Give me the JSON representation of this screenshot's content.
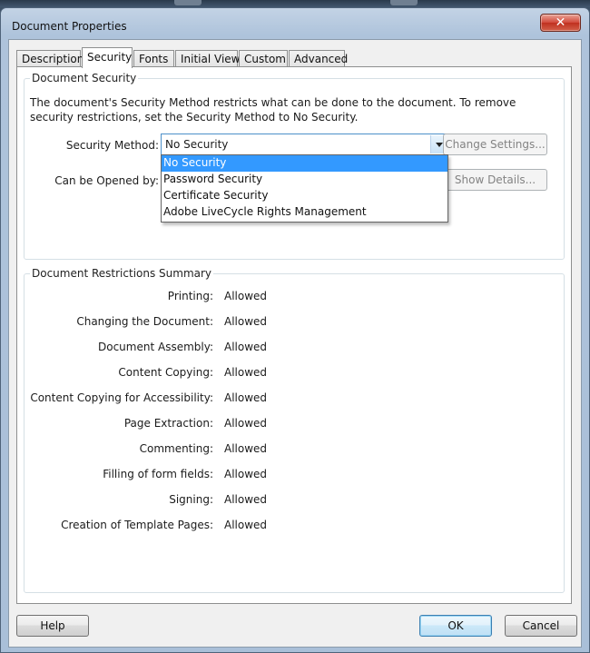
{
  "window": {
    "title": "Document Properties",
    "close_glyph": "✕"
  },
  "tabs": [
    {
      "label": "Description"
    },
    {
      "label": "Security"
    },
    {
      "label": "Fonts"
    },
    {
      "label": "Initial View"
    },
    {
      "label": "Custom"
    },
    {
      "label": "Advanced"
    }
  ],
  "active_tab": "Security",
  "security": {
    "group_title": "Document Security",
    "description": "The document's Security Method restricts what can be done to the document. To remove security restrictions, set the Security Method to No Security.",
    "method_label": "Security Method:",
    "method_value": "No Security",
    "method_options": [
      {
        "label": "No Security",
        "selected": true
      },
      {
        "label": "Password Security",
        "selected": false
      },
      {
        "label": "Certificate Security",
        "selected": false
      },
      {
        "label": "Adobe LiveCycle Rights Management",
        "selected": false
      }
    ],
    "opened_by_label": "Can be Opened by:",
    "change_settings_label": "Change Settings...",
    "show_details_label": "Show Details..."
  },
  "restrictions": {
    "group_title": "Document Restrictions Summary",
    "items": [
      {
        "label": "Printing:",
        "value": "Allowed"
      },
      {
        "label": "Changing the Document:",
        "value": "Allowed"
      },
      {
        "label": "Document Assembly:",
        "value": "Allowed"
      },
      {
        "label": "Content Copying:",
        "value": "Allowed"
      },
      {
        "label": "Content Copying for Accessibility:",
        "value": "Allowed"
      },
      {
        "label": "Page Extraction:",
        "value": "Allowed"
      },
      {
        "label": "Commenting:",
        "value": "Allowed"
      },
      {
        "label": "Filling of form fields:",
        "value": "Allowed"
      },
      {
        "label": "Signing:",
        "value": "Allowed"
      },
      {
        "label": "Creation of Template Pages:",
        "value": "Allowed"
      }
    ]
  },
  "footer": {
    "help_label": "Help",
    "ok_label": "OK",
    "cancel_label": "Cancel"
  },
  "colors": {
    "selection": "#3399ff",
    "close_button": "#c7402f",
    "title_bar": "#b8cbe0"
  }
}
